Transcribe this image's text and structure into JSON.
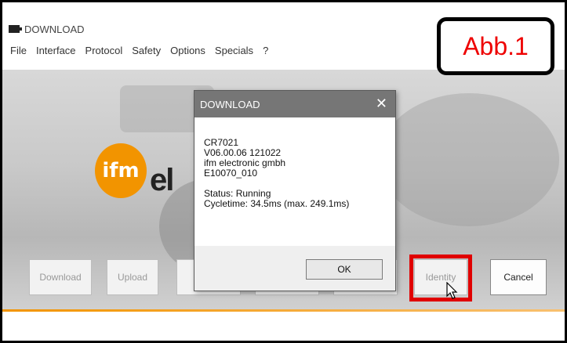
{
  "window": {
    "title": "DOWNLOAD"
  },
  "menu": [
    "File",
    "Interface",
    "Protocol",
    "Safety",
    "Options",
    "Specials",
    "?"
  ],
  "annotation_label": "Abb.1",
  "brand": {
    "logo_text": "ifm",
    "partial_text": "el"
  },
  "dialog": {
    "title": "DOWNLOAD",
    "close_glyph": "✕",
    "lines": [
      "CR7021",
      "V06.00.06 121022",
      "ifm electronic gmbh",
      "E10070_010"
    ],
    "status_lines": [
      "Status: Running",
      "Cycletime: 34.5ms (max. 249.1ms)"
    ],
    "ok_label": "OK"
  },
  "buttons": {
    "download": "Download",
    "upload": "Upload",
    "identity": "Identity",
    "cancel": "Cancel"
  },
  "colors": {
    "accent": "#f29400",
    "highlight": "#e00000",
    "dialog_title_bg": "#767676"
  }
}
